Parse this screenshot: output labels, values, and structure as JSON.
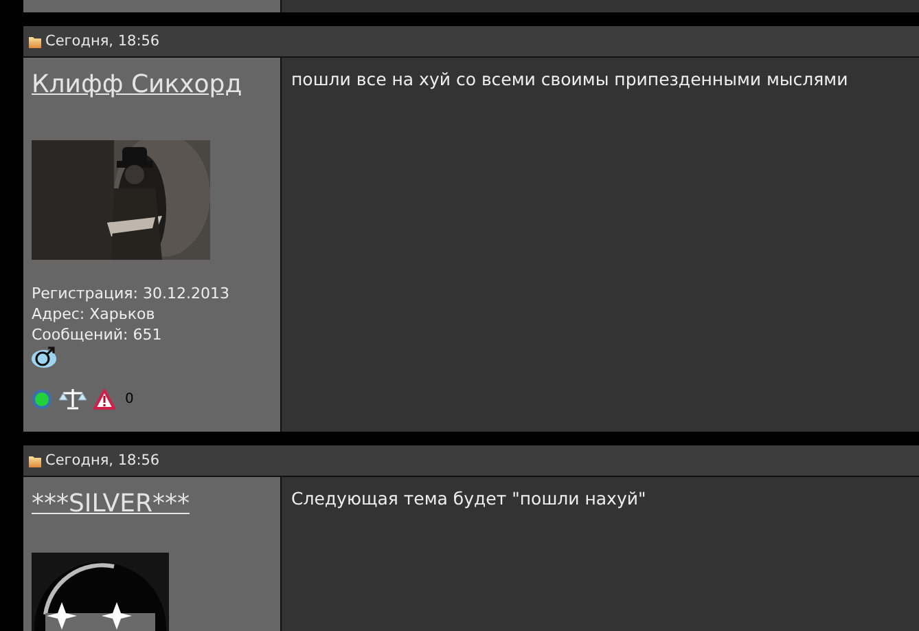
{
  "posts": [
    {
      "date": "Сегодня, 18:56",
      "author": "Клифф Сикхорд",
      "info": [
        "Регистрация: 30.12.2013",
        "Адрес: Харьков",
        "Сообщений: 651"
      ],
      "male": true,
      "status_icons": {
        "online": true,
        "warnings": "0"
      },
      "message": "пошли все на хуй со всеми своимы припезденными мыслями"
    },
    {
      "date": "Сегодня, 18:56",
      "author": "***SILVER***",
      "message": "Следующая тема будет \"пошли нахуй\""
    }
  ]
}
